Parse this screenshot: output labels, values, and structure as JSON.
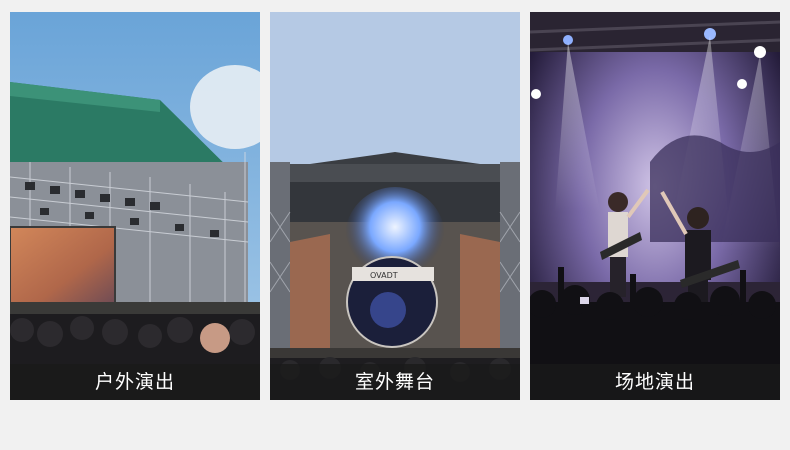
{
  "cards": [
    {
      "caption": "户外演出",
      "scene": "outdoor-concert-stage"
    },
    {
      "caption": "室外舞台",
      "scene": "outdoor-stage-truss"
    },
    {
      "caption": "场地演出",
      "scene": "indoor-venue-band"
    }
  ],
  "screen_text": "OVADT",
  "colors": {
    "page_background": "#f1f1f1",
    "caption_background": "#191919",
    "caption_text": "#ffffff"
  }
}
